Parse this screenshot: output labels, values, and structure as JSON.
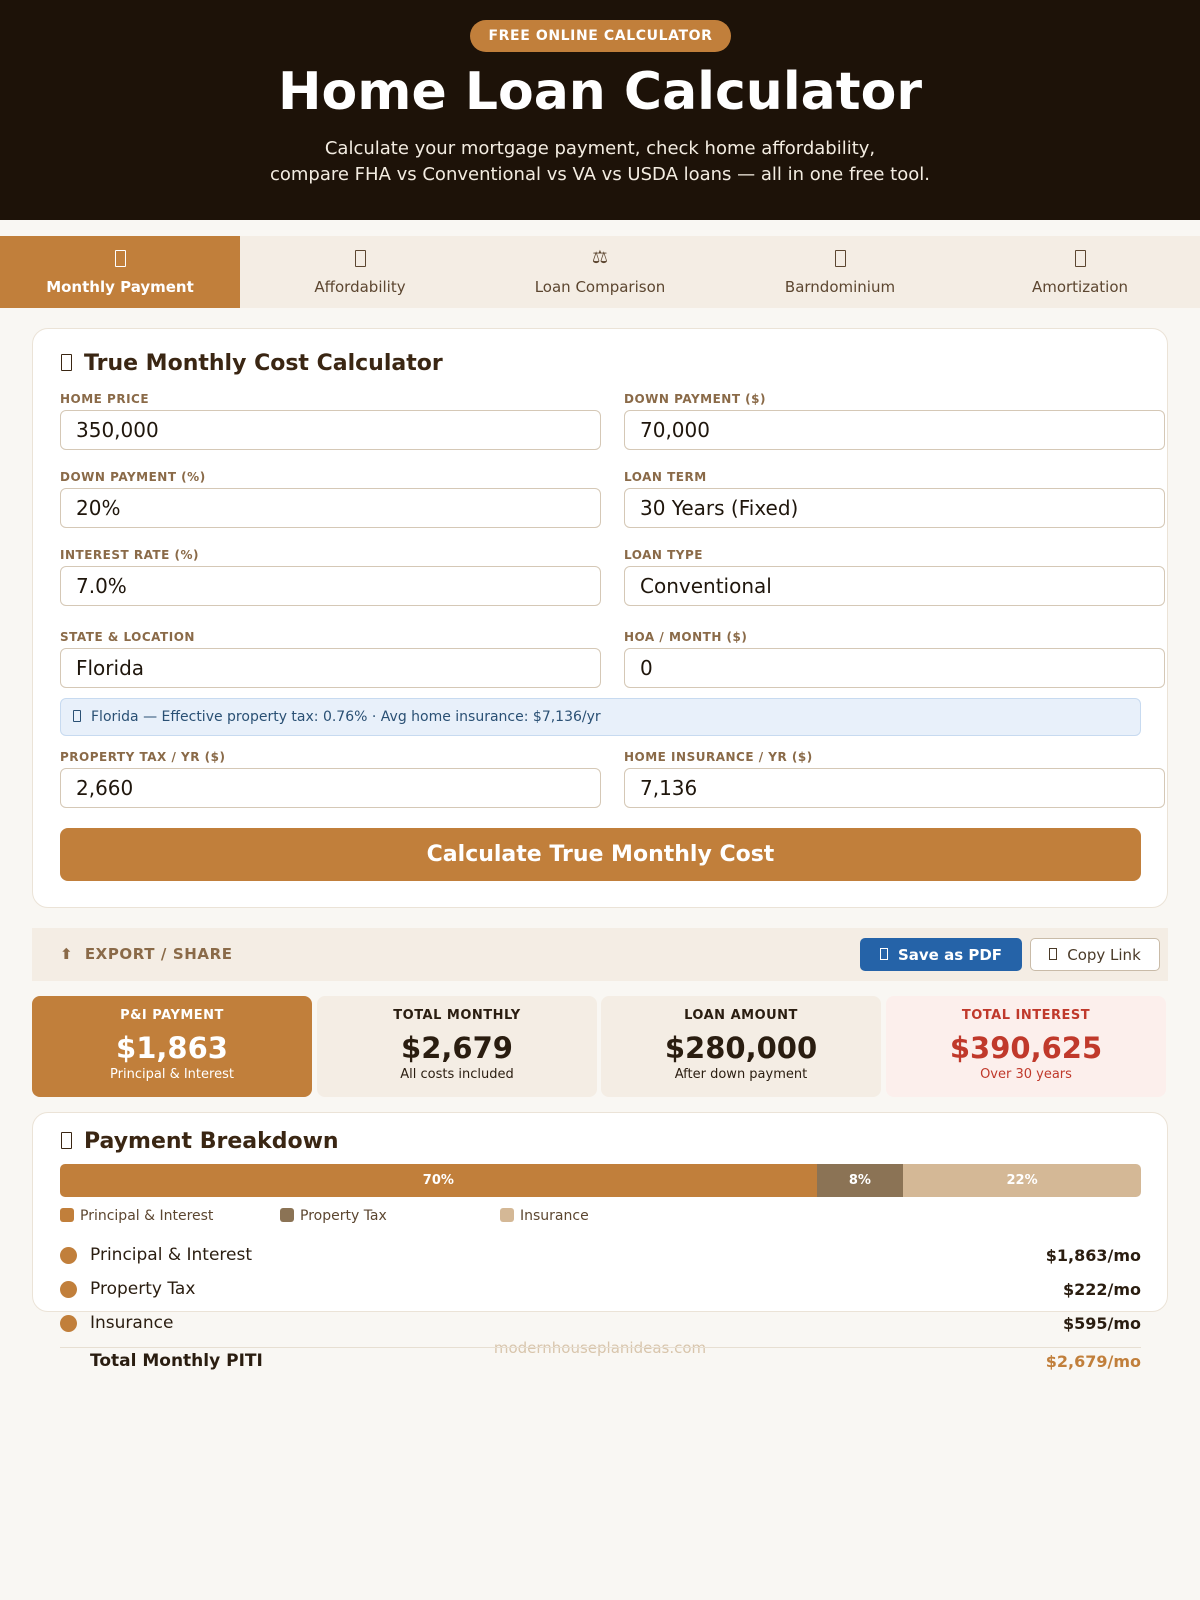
{
  "hero": {
    "badge": "FREE ONLINE CALCULATOR",
    "title": "Home Loan Calculator",
    "subtitle_line1": "Calculate your mortgage payment, check home affordability,",
    "subtitle_line2": "compare FHA vs Conventional vs VA vs USDA loans — all in one free tool."
  },
  "tabs": [
    {
      "label": "Monthly Payment",
      "icon": "calculator-icon",
      "active": true
    },
    {
      "label": "Affordability",
      "icon": "house-icon",
      "active": false
    },
    {
      "label": "Loan Comparison",
      "icon": "scale-icon",
      "glyph": "⚖",
      "active": false
    },
    {
      "label": "Barndominium",
      "icon": "barn-icon",
      "active": false
    },
    {
      "label": "Amortization",
      "icon": "chart-icon",
      "active": false
    }
  ],
  "calculator": {
    "title": "True Monthly Cost Calculator",
    "fields": {
      "home_price": {
        "label": "HOME PRICE",
        "value": "350,000"
      },
      "down_payment_amount": {
        "label": "DOWN PAYMENT ($)",
        "value": "70,000"
      },
      "down_payment_percent": {
        "label": "DOWN PAYMENT (%)",
        "value": "20%"
      },
      "loan_term": {
        "label": "LOAN TERM",
        "value": "30 Years (Fixed)"
      },
      "interest_rate": {
        "label": "INTEREST RATE (%)",
        "value": "7.0%"
      },
      "loan_type": {
        "label": "LOAN TYPE",
        "value": "Conventional"
      },
      "state": {
        "label": "STATE & LOCATION",
        "value": "Florida"
      },
      "hoa": {
        "label": "HOA / MONTH ($)",
        "value": "0"
      },
      "property_tax": {
        "label": "PROPERTY TAX / YR ($)",
        "value": "2,660"
      },
      "home_insurance": {
        "label": "HOME INSURANCE / YR ($)",
        "value": "7,136"
      }
    },
    "info": "Florida — Effective property tax: 0.76% · Avg home insurance: $7,136/yr",
    "button": "Calculate True Monthly Cost"
  },
  "export": {
    "label": "EXPORT / SHARE",
    "label_icon": "⬆",
    "pdf_button": "Save as PDF",
    "copy_button": "Copy Link"
  },
  "stats": [
    {
      "label": "P&I PAYMENT",
      "value": "$1,863",
      "sub": "Principal & Interest"
    },
    {
      "label": "TOTAL MONTHLY",
      "value": "$2,679",
      "sub": "All costs included"
    },
    {
      "label": "LOAN AMOUNT",
      "value": "$280,000",
      "sub": "After down payment"
    },
    {
      "label": "TOTAL INTEREST",
      "value": "$390,625",
      "sub": "Over 30 years"
    }
  ],
  "breakdown": {
    "title": "Payment Breakdown",
    "segments": [
      {
        "label": "70%",
        "percent": 70,
        "color": "#c17f3b"
      },
      {
        "label": "8%",
        "percent": 8,
        "color": "#8b7355"
      },
      {
        "label": "22%",
        "percent": 22,
        "color": "#d4b896"
      }
    ],
    "legend": [
      {
        "label": "Principal & Interest",
        "color": "#c17f3b"
      },
      {
        "label": "Property Tax",
        "color": "#8b7355"
      },
      {
        "label": "Insurance",
        "color": "#d4b896"
      }
    ],
    "rows": [
      {
        "label": "Principal & Interest",
        "value": "$1,863/mo"
      },
      {
        "label": "Property Tax",
        "value": "$222/mo"
      },
      {
        "label": "Insurance",
        "value": "$595/mo"
      }
    ],
    "total_label": "Total Monthly PITI",
    "total_value": "$2,679/mo"
  },
  "watermark": "modernhouseplanideas.com",
  "colors": {
    "accent": "#c17f3b",
    "dark": "#1d1208",
    "blue": "#2563a8",
    "red": "#c0392b"
  }
}
